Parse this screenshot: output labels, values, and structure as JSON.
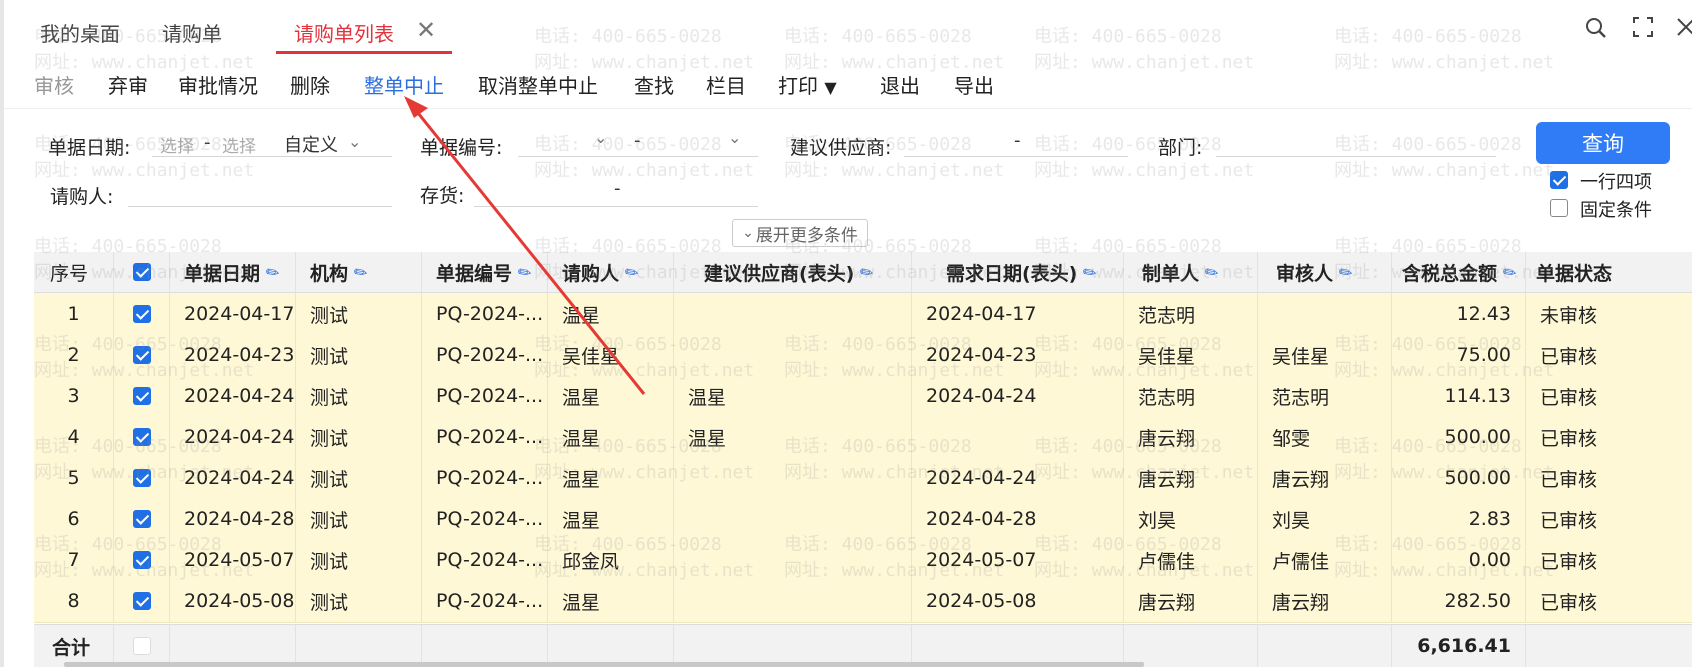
{
  "tabs": [
    {
      "label": "我的桌面",
      "active": false
    },
    {
      "label": "请购单",
      "active": false
    },
    {
      "label": "请购单列表",
      "active": true
    }
  ],
  "toolbar": {
    "items": [
      "审核",
      "弃审",
      "审批情况",
      "删除",
      "整单中止",
      "取消整单中止",
      "查找",
      "栏目",
      "打印",
      "退出",
      "导出"
    ]
  },
  "query": {
    "date_label": "单据日期:",
    "date_from_placeholder": "选择",
    "date_to_placeholder": "选择",
    "date_mode": "自定义",
    "doc_no_label": "单据编号:",
    "supplier_label": "建议供应商:",
    "dept_label": "部门:",
    "requester_label": "请购人:",
    "inventory_label": "存货:",
    "dash": "-",
    "query_button": "查询",
    "option_four_per_row": "一行四项",
    "option_fixed_conditions": "固定条件",
    "expand_label": "展开更多条件"
  },
  "table": {
    "columns": [
      "序号",
      "",
      "单据日期",
      "机构",
      "单据编号",
      "请购人",
      "建议供应商(表头)",
      "需求日期(表头)",
      "制单人",
      "审核人",
      "含税总金额",
      "单据状态"
    ],
    "rows": [
      [
        "1",
        "",
        "2024-04-17",
        "测试",
        "PQ-2024-...",
        "温星",
        "",
        "2024-04-17",
        "范志明",
        "",
        "12.43",
        "未审核"
      ],
      [
        "2",
        "",
        "2024-04-23",
        "测试",
        "PQ-2024-...",
        "吴佳星",
        "",
        "2024-04-23",
        "吴佳星",
        "吴佳星",
        "75.00",
        "已审核"
      ],
      [
        "3",
        "",
        "2024-04-24",
        "测试",
        "PQ-2024-...",
        "温星",
        "温星",
        "2024-04-24",
        "范志明",
        "范志明",
        "114.13",
        "已审核"
      ],
      [
        "4",
        "",
        "2024-04-24",
        "测试",
        "PQ-2024-...",
        "温星",
        "温星",
        "",
        "唐云翔",
        "邹雯",
        "500.00",
        "已审核"
      ],
      [
        "5",
        "",
        "2024-04-24",
        "测试",
        "PQ-2024-...",
        "温星",
        "",
        "2024-04-24",
        "唐云翔",
        "唐云翔",
        "500.00",
        "已审核"
      ],
      [
        "6",
        "",
        "2024-04-28",
        "测试",
        "PQ-2024-...",
        "温星",
        "",
        "2024-04-28",
        "刘昊",
        "刘昊",
        "2.83",
        "已审核"
      ],
      [
        "7",
        "",
        "2024-05-07",
        "测试",
        "PQ-2024-...",
        "邱金凤",
        "",
        "2024-05-07",
        "卢儒佳",
        "卢儒佳",
        "0.00",
        "已审核"
      ],
      [
        "8",
        "",
        "2024-05-08",
        "测试",
        "PQ-2024-...",
        "温星",
        "",
        "2024-05-08",
        "唐云翔",
        "唐云翔",
        "282.50",
        "已审核"
      ]
    ],
    "total_label": "合计",
    "total_amount": "6,616.41"
  },
  "watermark": {
    "phone": "电话: 400-665-0028",
    "site": "网址: www.chanjet.net"
  },
  "colors": {
    "accent_red": "#e2323c",
    "accent_blue": "#2f7cf6",
    "row_highlight": "#fff8d6"
  }
}
